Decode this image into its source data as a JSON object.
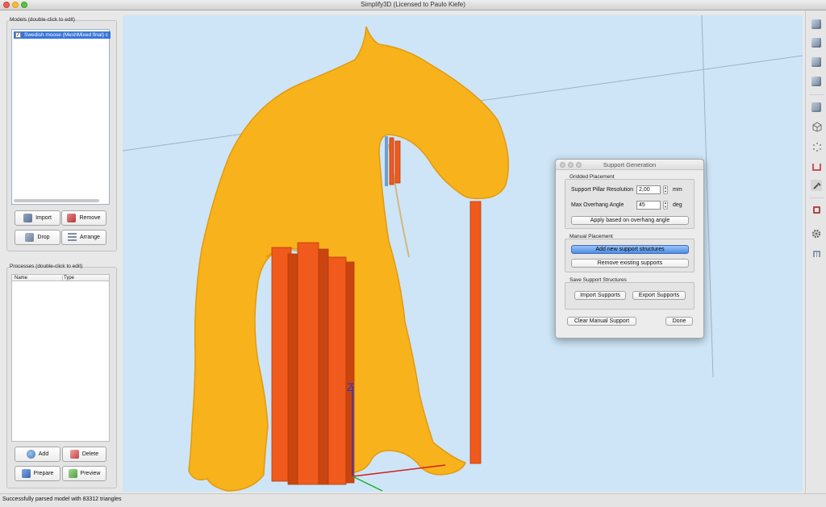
{
  "window": {
    "title": "Simplify3D (Licensed to Paulo Kiefe)"
  },
  "models": {
    "label": "Models (double-click to edit)",
    "items": [
      {
        "name": "Swedish moose (MeshMixed final) c",
        "checked": true
      }
    ],
    "buttons": {
      "import": "Import",
      "remove": "Remove",
      "drop": "Drop",
      "arrange": "Arrange"
    }
  },
  "processes": {
    "label": "Processes (double-click to edit)",
    "columns": [
      "Name",
      "Type"
    ],
    "buttons": {
      "add": "Add",
      "delete": "Delete",
      "prepare": "Prepare",
      "preview": "Preview"
    }
  },
  "status": {
    "text": "Successfully parsed model with 83312 triangles"
  },
  "viewport": {
    "axis_label": "Z",
    "colors": {
      "background": "#cde5f7",
      "model": "#f8b21b",
      "support": "#f05a1c"
    }
  },
  "support_dialog": {
    "title": "Support Generation",
    "gridded": {
      "label": "Gridded Placement",
      "resolution_label": "Support Pillar Resolution",
      "resolution_value": "2,00",
      "resolution_unit": "mm",
      "angle_label": "Max Overhang Angle",
      "angle_value": "45",
      "angle_unit": "deg",
      "apply_button": "Apply based on overhang angle"
    },
    "manual": {
      "label": "Manual Placement",
      "add_button": "Add new support structures",
      "remove_button": "Remove existing supports"
    },
    "save": {
      "label": "Save Support Structures",
      "import_button": "Import Supports",
      "export_button": "Export Supports"
    },
    "clear_button": "Clear Manual Support",
    "done_button": "Done"
  },
  "toolbar_icons": [
    "view-default-icon",
    "view-top-icon",
    "view-front-icon",
    "view-side-icon",
    "solid-view-icon",
    "wireframe-view-icon",
    "point-view-icon",
    "cross-section-icon",
    "support-tool-icon",
    "tool-icon",
    "settings-gear-icon",
    "print-icon"
  ]
}
